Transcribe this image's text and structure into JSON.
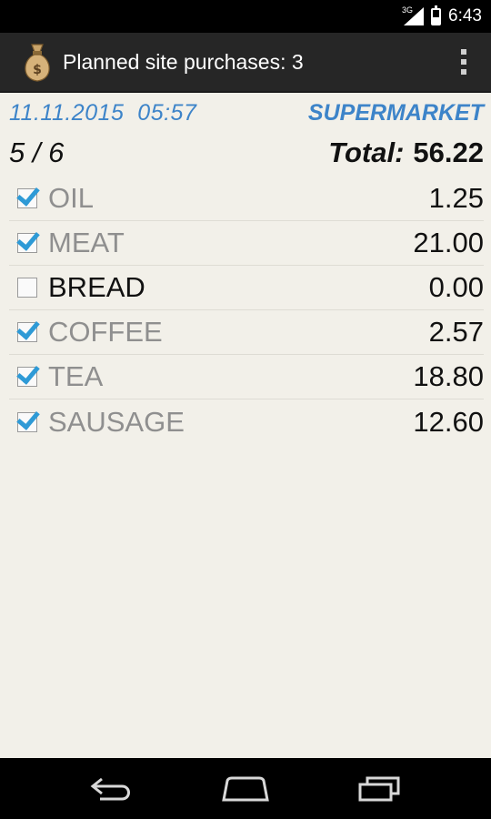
{
  "status": {
    "network": "3G",
    "time": "6:43"
  },
  "action_bar": {
    "title": "Planned site purchases: 3",
    "app_icon_name": "money-bag-icon"
  },
  "list_header": {
    "date": "11.11.2015  05:57",
    "store": "SUPERMARKET",
    "count": "5 / 6",
    "total_label": "Total:",
    "total_value": "56.22"
  },
  "items": [
    {
      "name": "OIL",
      "price": "1.25",
      "checked": true
    },
    {
      "name": "MEAT",
      "price": "21.00",
      "checked": true
    },
    {
      "name": "BREAD",
      "price": "0.00",
      "checked": false
    },
    {
      "name": "COFFEE",
      "price": "2.57",
      "checked": true
    },
    {
      "name": "TEA",
      "price": "18.80",
      "checked": true
    },
    {
      "name": "SAUSAGE",
      "price": "12.60",
      "checked": true
    }
  ],
  "colors": {
    "accent": "#3d84c9",
    "background": "#f2f0e9",
    "action_bar": "#262626",
    "check": "#2e9ad6"
  }
}
